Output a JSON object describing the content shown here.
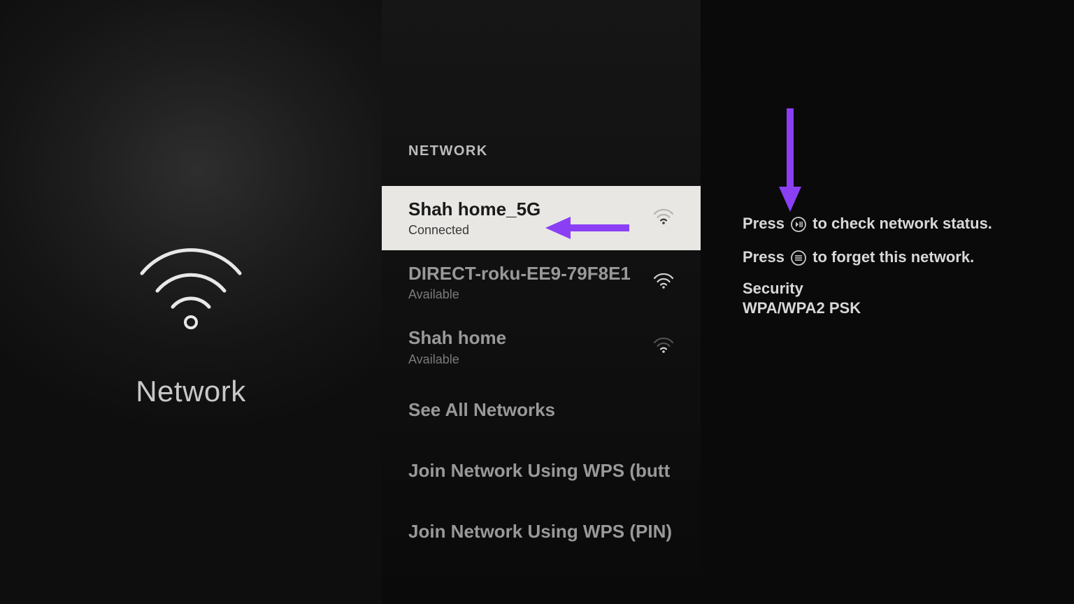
{
  "left": {
    "title": "Network"
  },
  "middle": {
    "header": "NETWORK",
    "networks": [
      {
        "name": "Shah home_5G",
        "status": "Connected",
        "selected": true,
        "signal": "weak"
      },
      {
        "name": "DIRECT-roku-EE9-79F8E1",
        "status": "Available",
        "selected": false,
        "signal": "strong"
      },
      {
        "name": "Shah home",
        "status": "Available",
        "selected": false,
        "signal": "weak"
      }
    ],
    "menu": {
      "see_all": "See All Networks",
      "wps_button": "Join Network Using WPS (butt",
      "wps_pin": "Join Network Using WPS (PIN)"
    }
  },
  "right": {
    "help1_pre": "Press ",
    "help1_post": " to check network status.",
    "help2_pre": "Press ",
    "help2_post": " to forget this network.",
    "security_label": "Security",
    "security_value": "WPA/WPA2 PSK"
  },
  "annotations": {
    "arrow_color": "#8b3ff5"
  }
}
